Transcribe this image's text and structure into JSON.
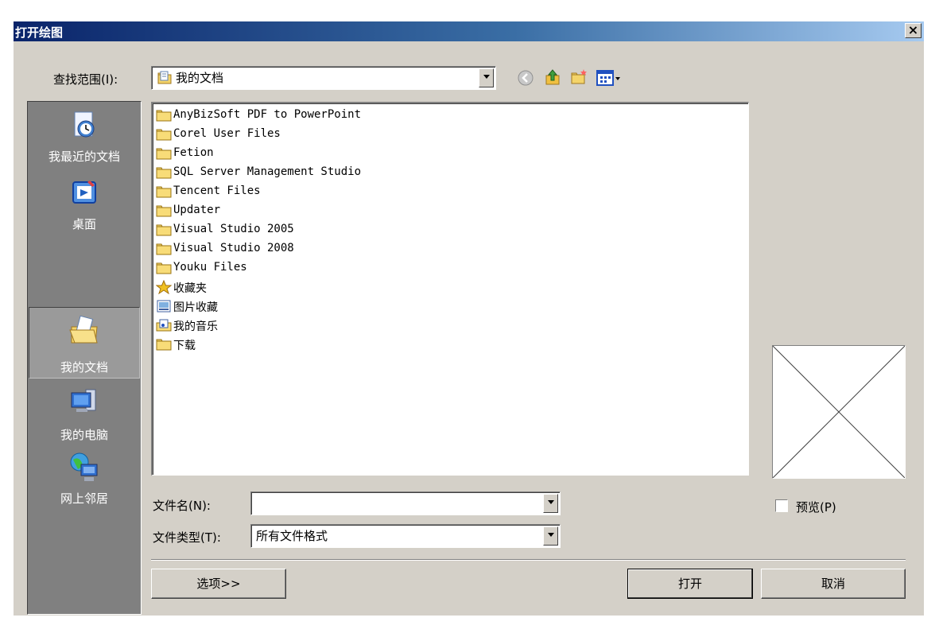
{
  "window": {
    "title": "打开绘图",
    "close_glyph": "×"
  },
  "lookin": {
    "label": "查找范围(I):",
    "value": "我的文档"
  },
  "toolbar": {
    "back": "back-icon",
    "up": "up-folder-icon",
    "newfolder": "new-folder-icon",
    "views": "views-menu-icon"
  },
  "places": [
    {
      "label": "我最近的文档",
      "icon": "recent-documents-icon"
    },
    {
      "label": "桌面",
      "icon": "desktop-icon"
    },
    {
      "label": "我的文档",
      "icon": "my-documents-icon",
      "selected": true
    },
    {
      "label": "我的电脑",
      "icon": "my-computer-icon"
    },
    {
      "label": "网上邻居",
      "icon": "network-places-icon"
    }
  ],
  "files": [
    {
      "name": "AnyBizSoft PDF to PowerPoint",
      "icon": "folder"
    },
    {
      "name": "Corel User Files",
      "icon": "folder"
    },
    {
      "name": "Fetion",
      "icon": "folder"
    },
    {
      "name": "SQL Server Management Studio",
      "icon": "folder"
    },
    {
      "name": "Tencent Files",
      "icon": "folder"
    },
    {
      "name": "Updater",
      "icon": "folder"
    },
    {
      "name": "Visual Studio 2005",
      "icon": "folder"
    },
    {
      "name": "Visual Studio 2008",
      "icon": "folder"
    },
    {
      "name": "Youku Files",
      "icon": "folder"
    },
    {
      "name": "收藏夹",
      "icon": "favorites"
    },
    {
      "name": "图片收藏",
      "icon": "pictures"
    },
    {
      "name": "我的音乐",
      "icon": "music"
    },
    {
      "name": "下载",
      "icon": "folder"
    }
  ],
  "filename": {
    "label": "文件名(N):",
    "value": ""
  },
  "filetype": {
    "label": "文件类型(T):",
    "value": "所有文件格式"
  },
  "preview": {
    "label": "预览(P)",
    "checked": false
  },
  "buttons": {
    "options": "选项>>",
    "open": "打开",
    "cancel": "取消"
  }
}
